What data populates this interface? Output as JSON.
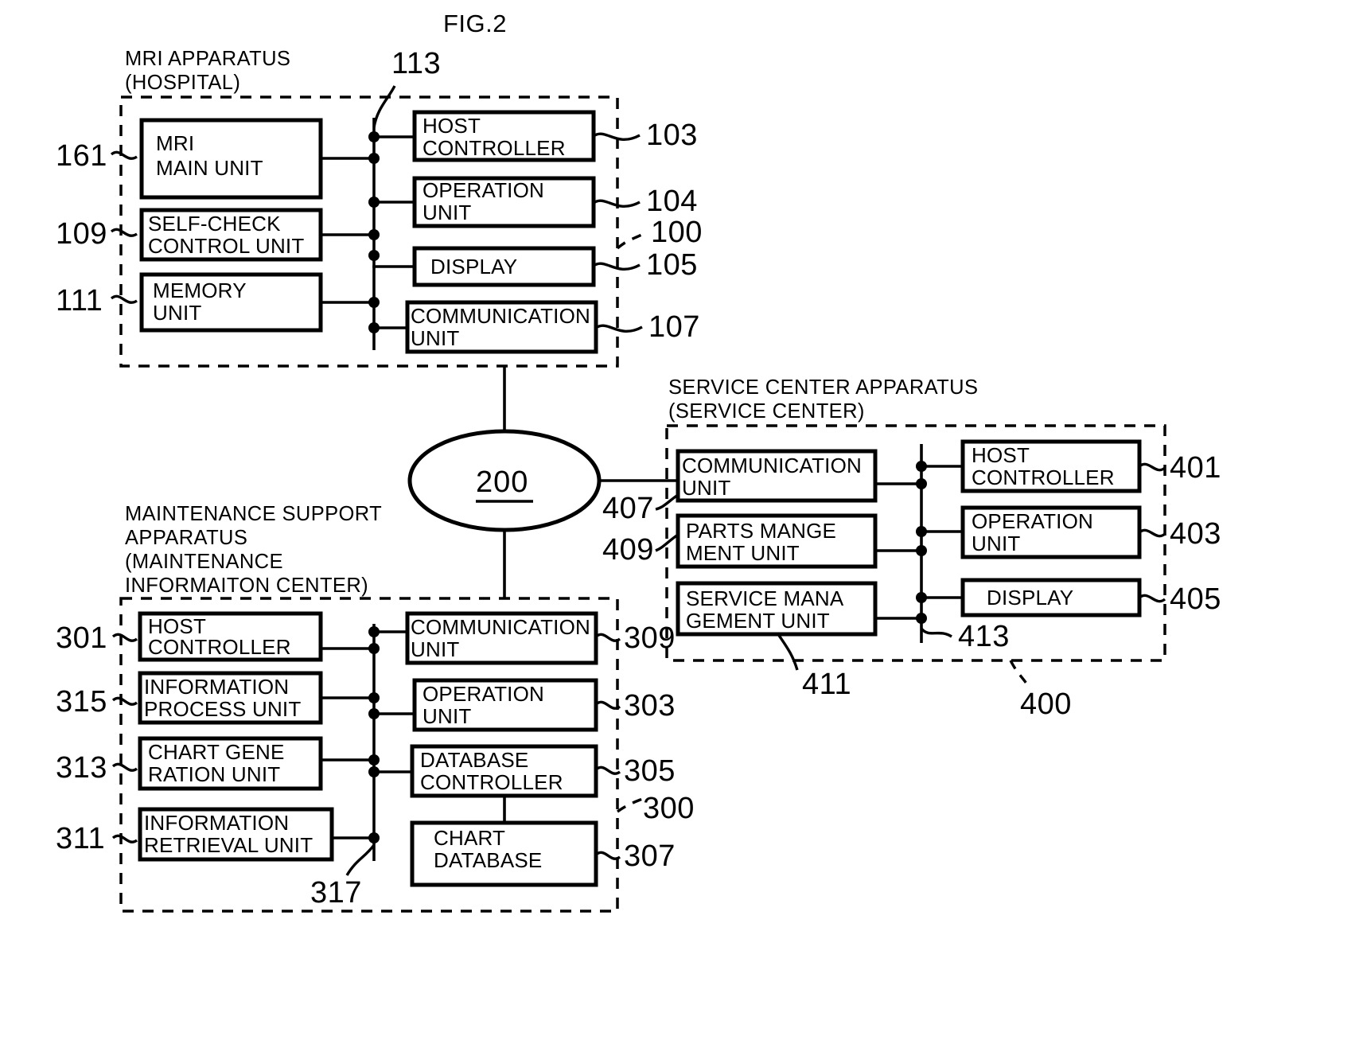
{
  "figure": {
    "title": "FIG.2"
  },
  "network": {
    "label": "200"
  },
  "groups": {
    "mri": {
      "title_line1": "MRI APPARATUS",
      "title_line2": "(HOSPITAL)",
      "group_ref": "100",
      "bus_ref": "113",
      "blocks": [
        {
          "ref": "161",
          "line1": "MRI",
          "line2": "MAIN UNIT"
        },
        {
          "ref": "109",
          "line1": "SELF-CHECK",
          "line2": "CONTROL UNIT"
        },
        {
          "ref": "111",
          "line1": "MEMORY",
          "line2": "UNIT"
        },
        {
          "ref": "103",
          "line1": "HOST",
          "line2": "CONTROLLER"
        },
        {
          "ref": "104",
          "line1": "OPERATION",
          "line2": "UNIT"
        },
        {
          "ref": "105",
          "line1": "DISPLAY",
          "line2": ""
        },
        {
          "ref": "107",
          "line1": "COMMUNICATION",
          "line2": "UNIT"
        }
      ]
    },
    "service": {
      "title_line1": "SERVICE CENTER APPARATUS",
      "title_line2": "(SERVICE CENTER)",
      "group_ref": "400",
      "bus_ref": "413",
      "extra_ref": "411",
      "blocks": [
        {
          "ref": "407",
          "line1": "COMMUNICATION",
          "line2": "UNIT"
        },
        {
          "ref": "409",
          "line1": "PARTS MANGE",
          "line2": "MENT UNIT"
        },
        {
          "ref": "411",
          "line1": "SERVICE MANA",
          "line2": "GEMENT UNIT"
        },
        {
          "ref": "401",
          "line1": "HOST",
          "line2": "CONTROLLER"
        },
        {
          "ref": "403",
          "line1": "OPERATION",
          "line2": "UNIT"
        },
        {
          "ref": "405",
          "line1": "DISPLAY",
          "line2": ""
        }
      ]
    },
    "maintenance": {
      "title_line1": "MAINTENANCE SUPPORT",
      "title_line2": "APPARATUS",
      "title_line3": "(MAINTENANCE",
      "title_line4": "INFORMAITON CENTER)",
      "group_ref": "300",
      "bus_ref": "317",
      "blocks": [
        {
          "ref": "301",
          "line1": "HOST",
          "line2": "CONTROLLER"
        },
        {
          "ref": "315",
          "line1": "INFORMATION",
          "line2": "PROCESS UNIT"
        },
        {
          "ref": "313",
          "line1": "CHART GENE",
          "line2": "RATION UNIT"
        },
        {
          "ref": "311",
          "line1": "INFORMATION",
          "line2": "RETRIEVAL UNIT"
        },
        {
          "ref": "309",
          "line1": "COMMUNICATION",
          "line2": "UNIT"
        },
        {
          "ref": "303",
          "line1": "OPERATION",
          "line2": "UNIT"
        },
        {
          "ref": "305",
          "line1": "DATABASE",
          "line2": "CONTROLLER"
        },
        {
          "ref": "307",
          "line1": "CHART",
          "line2": "DATABASE"
        }
      ]
    }
  }
}
